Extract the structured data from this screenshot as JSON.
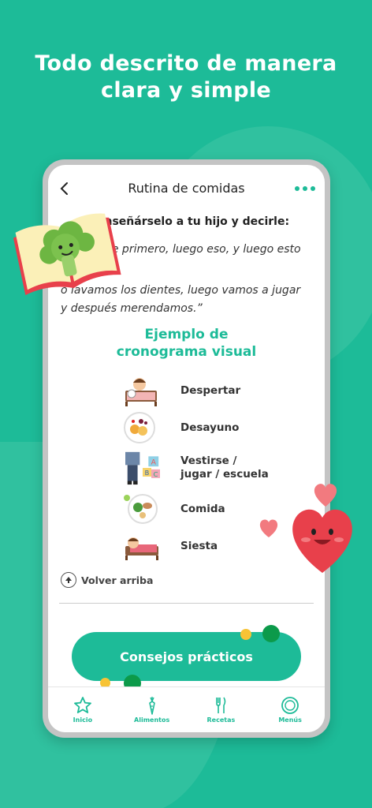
{
  "headline": {
    "line1": "Todo descrito de manera",
    "line2": "clara y simple"
  },
  "topbar": {
    "title": "Rutina de comidas",
    "back_icon": "chevron-left-icon",
    "more_icon": "more-dots-icon"
  },
  "content": {
    "intro_bold": "enseñárselo a tu hijo y decirle:",
    "intro_line1": "ne primero, luego eso, y luego esto",
    "intro_line2": "o lavamos los dientes, luego vamos a jugar",
    "intro_line3": "y después merendamos.”",
    "example_title_1": "Ejemplo de",
    "example_title_2": "cronograma visual",
    "schedule": [
      {
        "label": "Despertar",
        "icon": "child-waking-icon"
      },
      {
        "label": "Desayuno",
        "icon": "breakfast-plate-icon"
      },
      {
        "label": "Vestirse /\njugar / escuela",
        "icon": "clothes-blocks-icon"
      },
      {
        "label": "Comida",
        "icon": "lunch-plate-icon"
      },
      {
        "label": "Siesta",
        "icon": "child-sleeping-icon"
      }
    ],
    "back_to_top": "Volver arriba",
    "tips_button": "Consejos prácticos"
  },
  "bottom_nav": [
    {
      "label": "Inicio",
      "icon": "star-icon"
    },
    {
      "label": "Alimentos",
      "icon": "carrot-icon"
    },
    {
      "label": "Recetas",
      "icon": "cutlery-icon"
    },
    {
      "label": "Menús",
      "icon": "plate-icon"
    }
  ],
  "colors": {
    "brand_green": "#1dbb98",
    "dark_green": "#0c9a4a",
    "yellow": "#f7c335",
    "heart_red": "#e8404b",
    "heart_pink": "#f27a7f"
  }
}
